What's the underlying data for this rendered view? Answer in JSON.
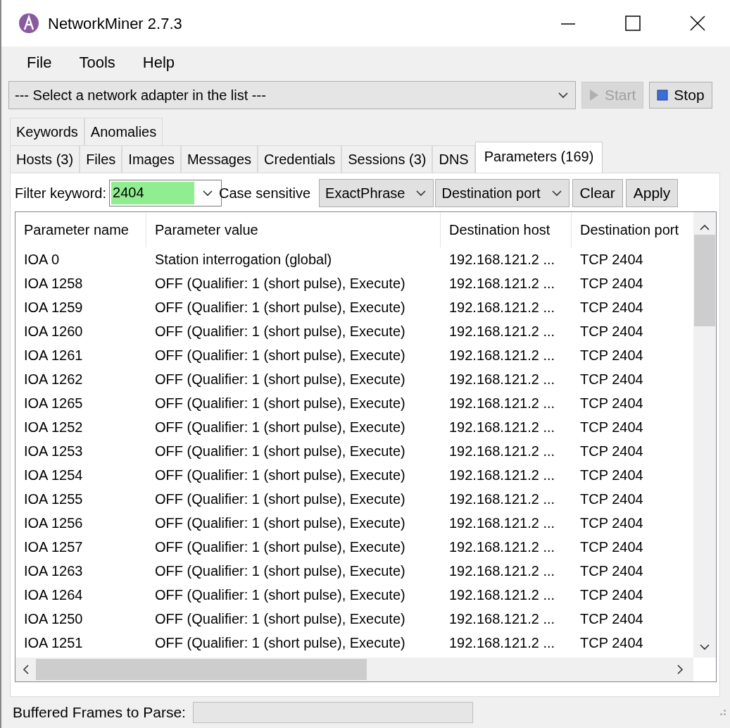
{
  "window": {
    "title": "NetworkMiner 2.7.3"
  },
  "menu": [
    "File",
    "Tools",
    "Help"
  ],
  "adapter": {
    "value": "--- Select a network adapter in the list ---"
  },
  "capture_buttons": [
    {
      "label": "Start",
      "kind": "start",
      "disabled": true
    },
    {
      "label": "Stop",
      "kind": "stop",
      "disabled": false
    }
  ],
  "tab_rows": [
    [
      {
        "label": "Keywords",
        "selected": false
      },
      {
        "label": "Anomalies",
        "selected": false
      }
    ],
    [
      {
        "label": "Hosts (3)",
        "selected": false
      },
      {
        "label": "Files",
        "selected": false
      },
      {
        "label": "Images",
        "selected": false
      },
      {
        "label": "Messages",
        "selected": false
      },
      {
        "label": "Credentials",
        "selected": false
      },
      {
        "label": "Sessions (3)",
        "selected": false
      },
      {
        "label": "DNS",
        "selected": false
      },
      {
        "label": "Parameters (169)",
        "selected": true
      }
    ]
  ],
  "filter": {
    "label": "Filter keyword:",
    "value": "2404",
    "case_sensitive": "Case sensitive",
    "match_mode": "ExactPhrase",
    "field": "Destination port",
    "buttons": [
      "Clear",
      "Apply"
    ]
  },
  "table": {
    "columns": [
      "Parameter name",
      "Parameter value",
      "Destination host",
      "Destination port"
    ],
    "rows": [
      [
        "IOA 0",
        "Station interrogation (global)",
        "192.168.121.2 ...",
        "TCP 2404"
      ],
      [
        "IOA 1258",
        "OFF (Qualifier: 1 (short pulse),  Execute)",
        "192.168.121.2 ...",
        "TCP 2404"
      ],
      [
        "IOA 1259",
        "OFF (Qualifier: 1 (short pulse),  Execute)",
        "192.168.121.2 ...",
        "TCP 2404"
      ],
      [
        "IOA 1260",
        "OFF (Qualifier: 1 (short pulse),  Execute)",
        "192.168.121.2 ...",
        "TCP 2404"
      ],
      [
        "IOA 1261",
        "OFF (Qualifier: 1 (short pulse),  Execute)",
        "192.168.121.2 ...",
        "TCP 2404"
      ],
      [
        "IOA 1262",
        "OFF (Qualifier: 1 (short pulse),  Execute)",
        "192.168.121.2 ...",
        "TCP 2404"
      ],
      [
        "IOA 1265",
        "OFF (Qualifier: 1 (short pulse),  Execute)",
        "192.168.121.2 ...",
        "TCP 2404"
      ],
      [
        "IOA 1252",
        "OFF (Qualifier: 1 (short pulse),  Execute)",
        "192.168.121.2 ...",
        "TCP 2404"
      ],
      [
        "IOA 1253",
        "OFF (Qualifier: 1 (short pulse),  Execute)",
        "192.168.121.2 ...",
        "TCP 2404"
      ],
      [
        "IOA 1254",
        "OFF (Qualifier: 1 (short pulse),  Execute)",
        "192.168.121.2 ...",
        "TCP 2404"
      ],
      [
        "IOA 1255",
        "OFF (Qualifier: 1 (short pulse),  Execute)",
        "192.168.121.2 ...",
        "TCP 2404"
      ],
      [
        "IOA 1256",
        "OFF (Qualifier: 1 (short pulse),  Execute)",
        "192.168.121.2 ...",
        "TCP 2404"
      ],
      [
        "IOA 1257",
        "OFF (Qualifier: 1 (short pulse),  Execute)",
        "192.168.121.2 ...",
        "TCP 2404"
      ],
      [
        "IOA 1263",
        "OFF (Qualifier: 1 (short pulse),  Execute)",
        "192.168.121.2 ...",
        "TCP 2404"
      ],
      [
        "IOA 1264",
        "OFF (Qualifier: 1 (short pulse),  Execute)",
        "192.168.121.2 ...",
        "TCP 2404"
      ],
      [
        "IOA 1250",
        "OFF (Qualifier: 1 (short pulse),  Execute)",
        "192.168.121.2 ...",
        "TCP 2404"
      ],
      [
        "IOA 1251",
        "OFF (Qualifier: 1 (short pulse),  Execute)",
        "192.168.121.2 ...",
        "TCP 2404"
      ]
    ]
  },
  "status_bar": {
    "label": "Buffered Frames to Parse:",
    "level": 0
  }
}
